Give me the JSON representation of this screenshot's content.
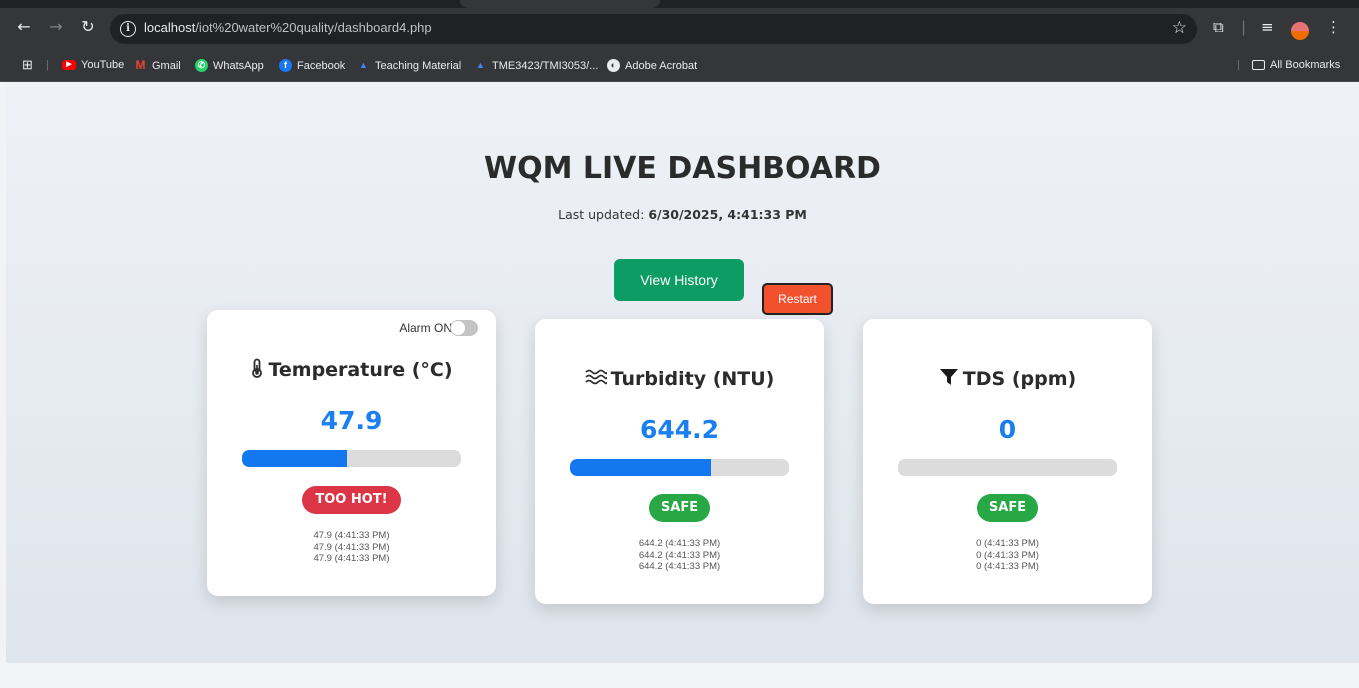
{
  "browser": {
    "url_host": "localhost",
    "url_path": "/iot%20water%20quality/dashboard4.php",
    "bookmarks": [
      {
        "label": "YouTube",
        "icon": "youtube-icon",
        "color": "#ff0000"
      },
      {
        "label": "Gmail",
        "icon": "gmail-icon",
        "color": "#ea4335"
      },
      {
        "label": "WhatsApp",
        "icon": "whatsapp-icon",
        "color": "#25d366"
      },
      {
        "label": "Facebook",
        "icon": "facebook-icon",
        "color": "#1877f2"
      },
      {
        "label": "Teaching Material",
        "icon": "drive-icon",
        "color": "#4285f4"
      },
      {
        "label": "TME3423/TMI3053/...",
        "icon": "drive-icon",
        "color": "#4285f4"
      },
      {
        "label": "Adobe Acrobat",
        "icon": "globe-icon",
        "color": "#9aa0a6"
      }
    ],
    "all_bookmarks": "All Bookmarks"
  },
  "dashboard": {
    "title": "WQM LIVE DASHBOARD",
    "last_updated_label": "Last updated:",
    "last_updated_value": "6/30/2025, 4:41:33 PM",
    "view_history": "View History",
    "restart": "Restart"
  },
  "cards": [
    {
      "icon": "thermometer-icon",
      "title": "Temperature (°C)",
      "value": "47.9",
      "level": 0.48,
      "status": "TOO HOT!",
      "status_color": "#dc3545",
      "alarm_label": "Alarm ON",
      "history": [
        "47.9 (4:41:33 PM)",
        "47.9 (4:41:33 PM)",
        "47.9 (4:41:33 PM)"
      ]
    },
    {
      "icon": "water-waves-icon",
      "title": "Turbidity (NTU)",
      "value": "644.2",
      "level": 0.645,
      "status": "SAFE",
      "status_color": "#28a745",
      "history": [
        "644.2 (4:41:33 PM)",
        "644.2 (4:41:33 PM)",
        "644.2 (4:41:33 PM)"
      ]
    },
    {
      "icon": "filter-icon",
      "title": "TDS (ppm)",
      "value": "0",
      "level": 0,
      "status": "SAFE",
      "status_color": "#28a745",
      "history": [
        "0 (4:41:33 PM)",
        "0 (4:41:33 PM)",
        "0 (4:41:33 PM)"
      ]
    }
  ]
}
